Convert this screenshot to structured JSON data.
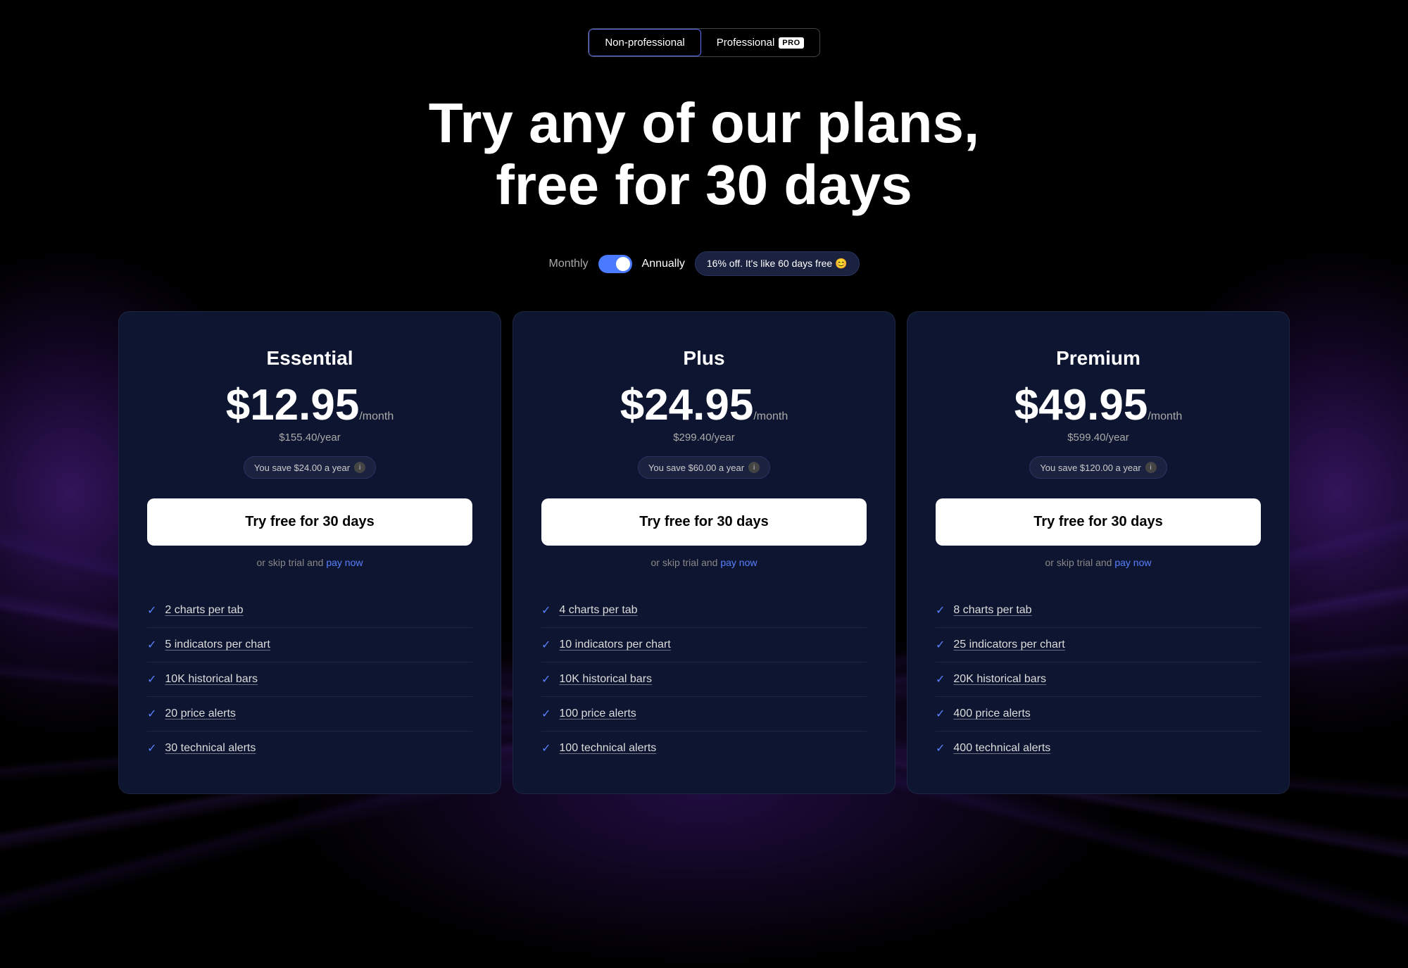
{
  "header": {
    "toggle_nonpro_label": "Non-professional",
    "toggle_pro_label": "Professional",
    "pro_badge": "PRO"
  },
  "hero": {
    "heading_line1": "Try any of our plans,",
    "heading_line2": "free for 30 days"
  },
  "billing": {
    "monthly_label": "Monthly",
    "annually_label": "Annually",
    "discount_badge": "16% off. It's like 60 days free 😊",
    "toggle_state": "on"
  },
  "plans": [
    {
      "name": "Essential",
      "price": "$12.95",
      "period": "/month",
      "year_price": "$155.40/year",
      "savings": "You save $24.00 a year",
      "cta": "Try free for 30 days",
      "skip_text": "or skip trial and",
      "pay_now": "pay now",
      "features": [
        "2 charts per tab",
        "5 indicators per chart",
        "10K historical bars",
        "20 price alerts",
        "30 technical alerts"
      ]
    },
    {
      "name": "Plus",
      "price": "$24.95",
      "period": "/month",
      "year_price": "$299.40/year",
      "savings": "You save $60.00 a year",
      "cta": "Try free for 30 days",
      "skip_text": "or skip trial and",
      "pay_now": "pay now",
      "features": [
        "4 charts per tab",
        "10 indicators per chart",
        "10K historical bars",
        "100 price alerts",
        "100 technical alerts"
      ]
    },
    {
      "name": "Premium",
      "price": "$49.95",
      "period": "/month",
      "year_price": "$599.40/year",
      "savings": "You save $120.00 a year",
      "cta": "Try free for 30 days",
      "skip_text": "or skip trial and",
      "pay_now": "pay now",
      "features": [
        "8 charts per tab",
        "25 indicators per chart",
        "20K historical bars",
        "400 price alerts",
        "400 technical alerts"
      ]
    }
  ]
}
